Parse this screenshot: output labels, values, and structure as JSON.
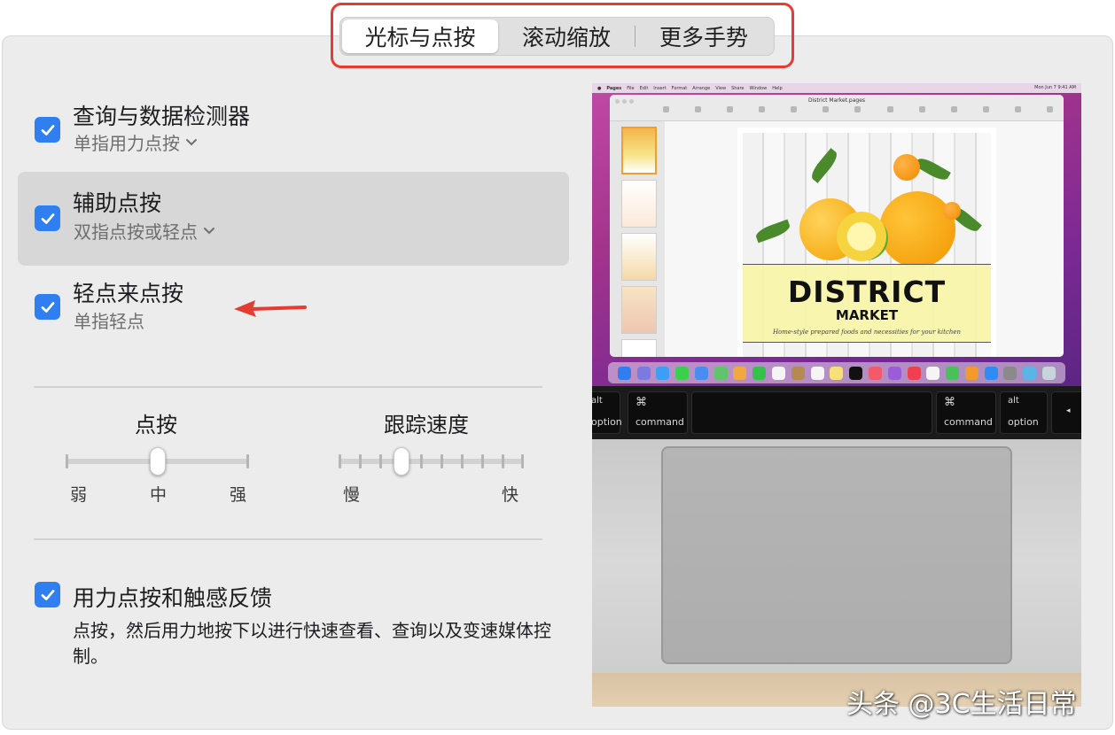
{
  "tabs": [
    {
      "label": "光标与点按",
      "active": true
    },
    {
      "label": "滚动缩放",
      "active": false
    },
    {
      "label": "更多手势",
      "active": false
    }
  ],
  "options": {
    "lookup": {
      "title": "查询与数据检测器",
      "subtitle": "单指用力点按",
      "checked": true
    },
    "secondary_click": {
      "title": "辅助点按",
      "subtitle": "双指点按或轻点",
      "checked": true
    },
    "tap_to_click": {
      "title": "轻点来点按",
      "subtitle": "单指轻点",
      "checked": true
    },
    "force_click": {
      "title": "用力点按和触感反馈",
      "description": "点按，然后用力地按下以进行快速查看、查询以及变速媒体控制。",
      "checked": true
    }
  },
  "sliders": {
    "click": {
      "title": "点按",
      "labels": [
        "弱",
        "中",
        "强"
      ],
      "value_index": 1,
      "tick_count": 3
    },
    "tracking": {
      "title": "跟踪速度",
      "min_label": "慢",
      "max_label": "快",
      "value_index": 3,
      "tick_count": 10
    }
  },
  "preview": {
    "menubar": [
      "Pages",
      "File",
      "Edit",
      "Insert",
      "Format",
      "Arrange",
      "View",
      "Share",
      "Window",
      "Help"
    ],
    "menubar_clock": "Mon Jun 7 9:41 AM",
    "window_title": "District Market.pages",
    "poster": {
      "title": "DISTRICT",
      "subtitle": "MARKET",
      "tagline": "Home-style prepared foods and necessities for your kitchen"
    },
    "keys": {
      "left_option_top": "alt",
      "left_option_label": "option",
      "left_command_symbol": "⌘",
      "left_command_label": "command",
      "right_command_symbol": "⌘",
      "right_command_label": "command",
      "right_option_top": "alt",
      "right_option_label": "option",
      "arrow_label": "◂"
    }
  },
  "watermark": "头条 @3C生活日常",
  "colors": {
    "accent": "#2f7ff0",
    "highlight": "#e53b30",
    "arrow": "#e53b30"
  }
}
